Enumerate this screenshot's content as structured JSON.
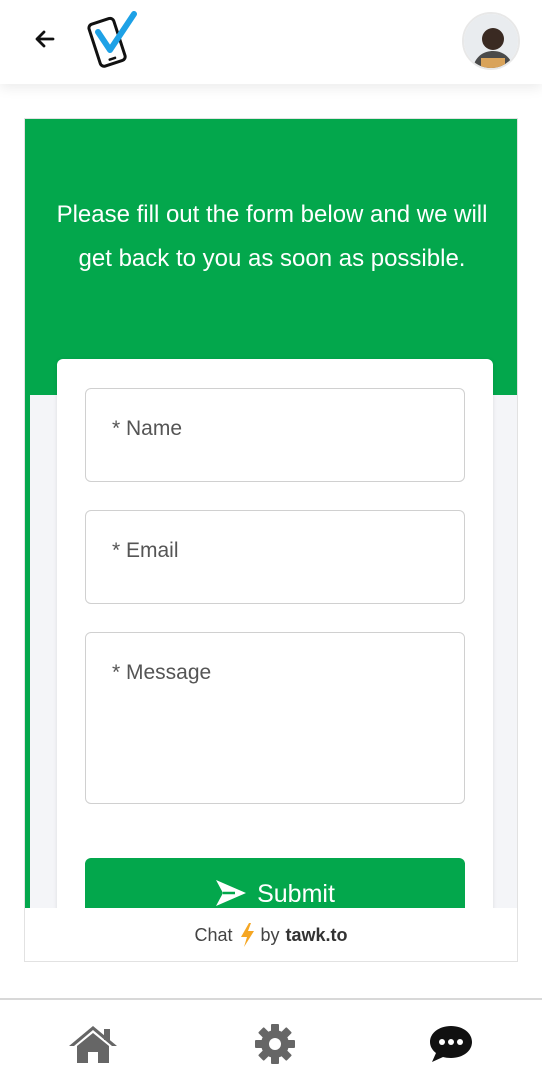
{
  "topbar": {
    "back_icon": "arrow-left-icon",
    "logo_icon": "phone-check-logo",
    "avatar_icon": "user-avatar"
  },
  "widget": {
    "header_text": "Please fill out the form below and we will get back to you as soon as possible.",
    "fields": {
      "name_placeholder": "* Name",
      "email_placeholder": "* Email",
      "message_placeholder": "* Message"
    },
    "submit_label": "Submit",
    "footer": {
      "chat_label": "Chat",
      "by_label": "by",
      "brand": "tawk.to"
    },
    "colors": {
      "accent": "#03a74c",
      "lightning": "#f5a623"
    }
  },
  "bottom_nav": {
    "items": [
      {
        "icon": "home-icon"
      },
      {
        "icon": "gear-icon"
      },
      {
        "icon": "chat-bubble-icon"
      }
    ]
  }
}
